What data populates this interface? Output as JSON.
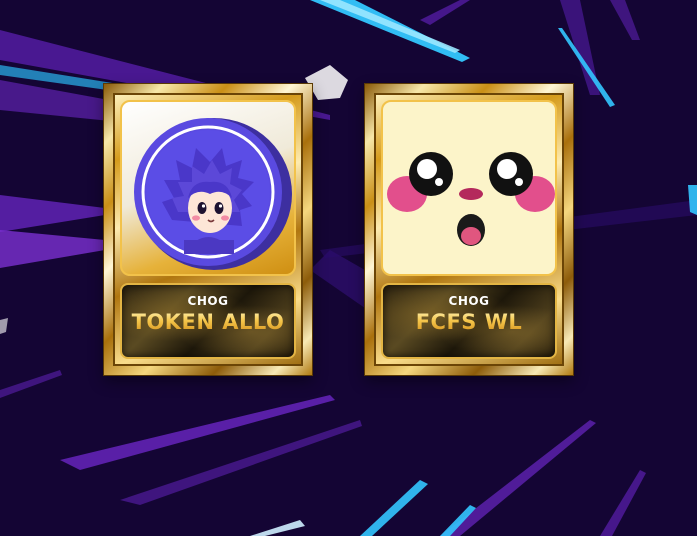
{
  "cards": [
    {
      "subtitle": "CHOG",
      "title": "TOKEN ALLO",
      "art_icon": "chog-coin-icon"
    },
    {
      "subtitle": "CHOG",
      "title": "FCFS WL",
      "art_icon": "chog-face-icon"
    }
  ],
  "colors": {
    "background": "#140534",
    "gold": "#d59b1c",
    "streak_purple": "#7b2fd1",
    "streak_cyan": "#33c7ff",
    "label_text": "#f1c14a"
  }
}
